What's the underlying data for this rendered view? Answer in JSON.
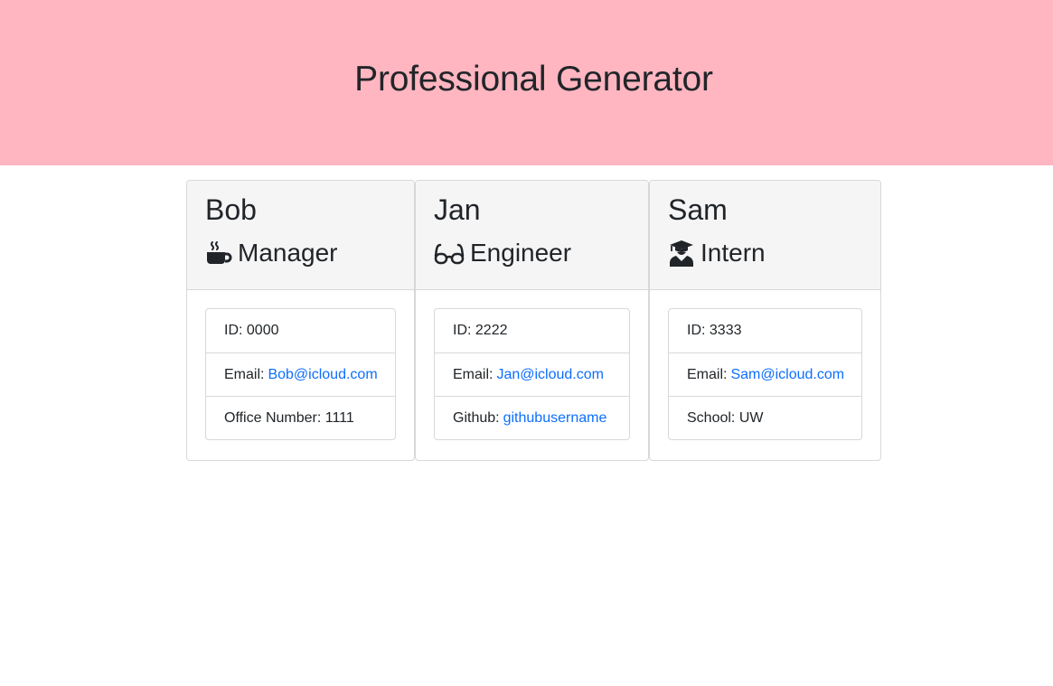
{
  "page": {
    "title": "Professional Generator"
  },
  "colors": {
    "header_bg": "#ffb6c1",
    "link": "#0d6efd"
  },
  "employees": [
    {
      "name": "Bob",
      "role": "Manager",
      "icon": "coffee-mug-icon",
      "id_text": "ID: 0000",
      "email_label": "Email:",
      "email": "Bob@icloud.com",
      "extra_text": "Office Number: 1111"
    },
    {
      "name": "Jan",
      "role": "Engineer",
      "icon": "glasses-icon",
      "id_text": "ID: 2222",
      "email_label": "Email:",
      "email": "Jan@icloud.com",
      "extra_label": "Github:",
      "extra_link": "githubusername"
    },
    {
      "name": "Sam",
      "role": "Intern",
      "icon": "graduate-icon",
      "id_text": "ID: 3333",
      "email_label": "Email:",
      "email": "Sam@icloud.com",
      "extra_text": "School: UW"
    }
  ]
}
